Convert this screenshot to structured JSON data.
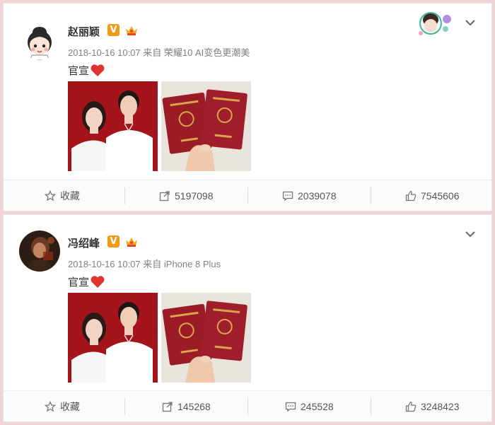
{
  "posts": [
    {
      "username": "赵丽颖",
      "verified_label": "V",
      "timestamp": "2018-10-16 10:07",
      "source": "来自 荣耀10 AI变色更潮美",
      "text": "官宣",
      "actions": {
        "favorite_label": "收藏",
        "repost_count": "5197098",
        "comment_count": "2039078",
        "like_count": "7545606"
      },
      "avatar_icon": "cartoon-girl-avatar",
      "highlighted": true
    },
    {
      "username": "冯绍峰",
      "verified_label": "V",
      "timestamp": "2018-10-16 10:07",
      "source": "来自 iPhone 8 Plus",
      "text": "官宣",
      "actions": {
        "favorite_label": "收藏",
        "repost_count": "145268",
        "comment_count": "245528",
        "like_count": "3248423"
      },
      "avatar_icon": "portrait-avatar",
      "highlighted": false
    }
  ],
  "colors": {
    "page_background": "#f1d4d6",
    "verified_badge": "#f39a12",
    "heart": "#e0322f",
    "photo_background_red": "#a5141a",
    "certificate_red": "#9b1b27"
  }
}
